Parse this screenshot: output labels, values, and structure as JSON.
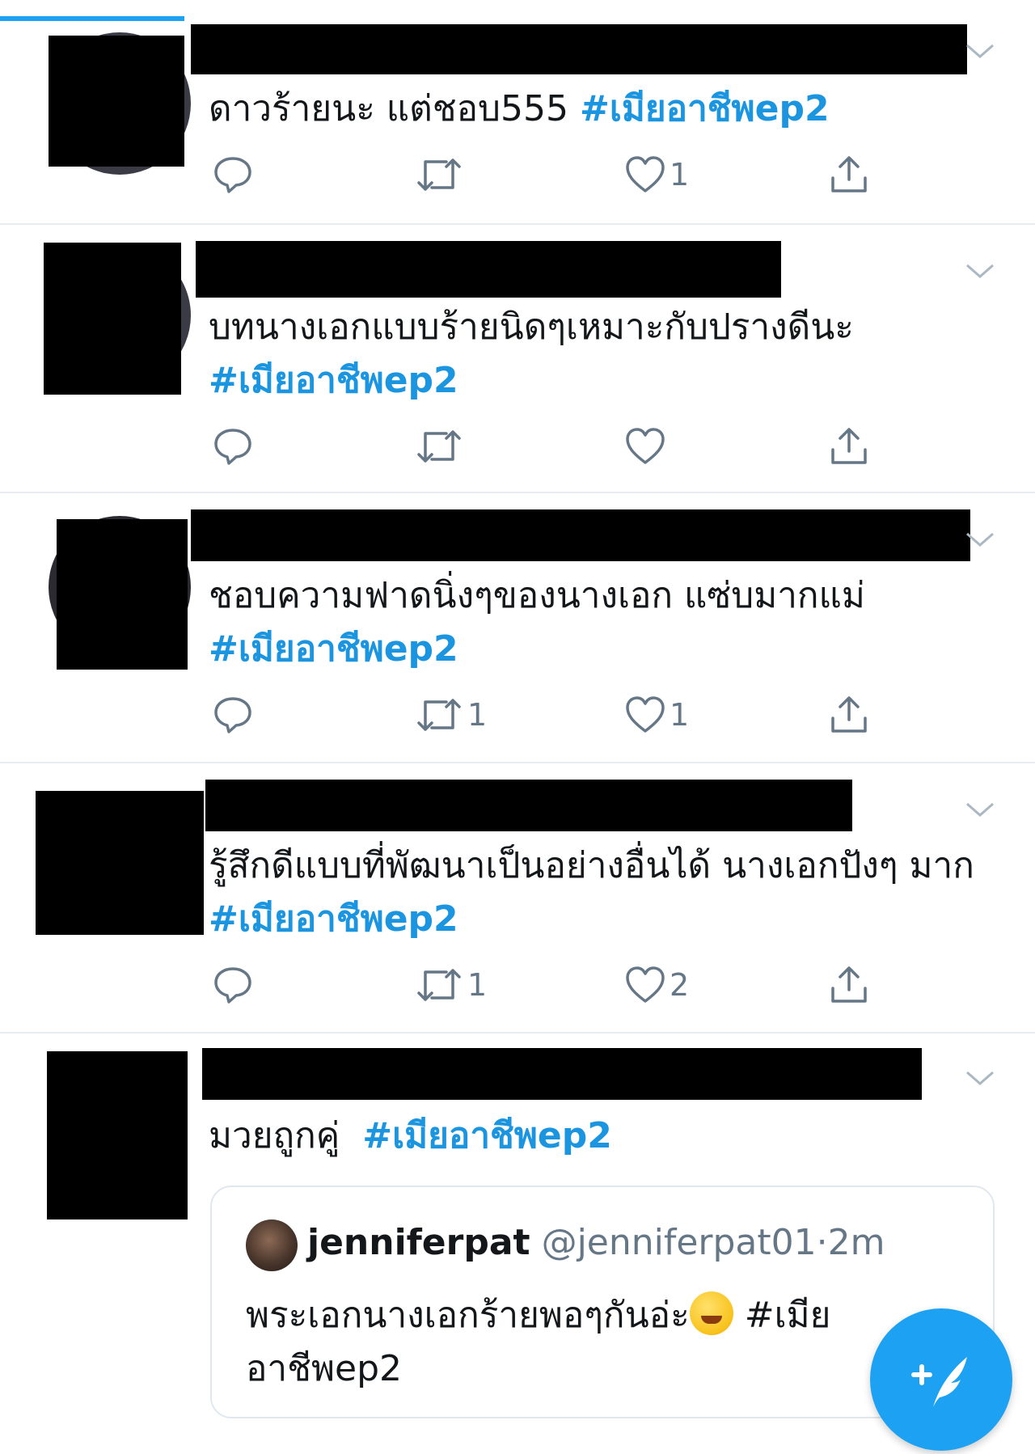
{
  "colors": {
    "accent": "#1da1f2",
    "hashtag": "#1b95e0",
    "muted": "#657786",
    "divider": "#e6ecf0"
  },
  "tweets": [
    {
      "text": "ดาวร้ายนะ แต่ชอบ555",
      "hashtag": "#เมียอาชีพep2",
      "reply_count": "",
      "retweet_count": "",
      "like_count": "1"
    },
    {
      "text": "บทนางเอกแบบร้ายนิดๆเหมาะกับปรางดีนะ",
      "hashtag": "#เมียอาชีพep2",
      "reply_count": "",
      "retweet_count": "",
      "like_count": ""
    },
    {
      "text": "ชอบความฟาดนิ่งๆของนางเอก แซ่บมากแม่",
      "hashtag": "#เมียอาชีพep2",
      "reply_count": "",
      "retweet_count": "1",
      "like_count": "1"
    },
    {
      "text": "รู้สึกดีแบบที่พัฒนาเป็นอย่างอื่นได้ นางเอกปังๆ มาก",
      "hashtag": "#เมียอาชีพep2",
      "reply_count": "",
      "retweet_count": "1",
      "like_count": "2"
    },
    {
      "text": "มวยถูกคู่",
      "hashtag": "#เมียอาชีพep2"
    }
  ],
  "quoted_tweet": {
    "name": "jenniferpat",
    "handle": "@jenniferpat01",
    "separator": "·",
    "time": "2m",
    "text_before_emoji": "พระเอกนางเอกร้ายพอๆกันอ่ะ",
    "emoji": "rolling-on-floor-laughing",
    "text_after_emoji": " #เมียอาชีพep2"
  },
  "icons": {
    "reply": "reply-icon",
    "retweet": "retweet-icon",
    "like": "heart-icon",
    "share": "share-icon",
    "compose": "compose-tweet-icon",
    "chevron": "chevron-down-icon"
  }
}
